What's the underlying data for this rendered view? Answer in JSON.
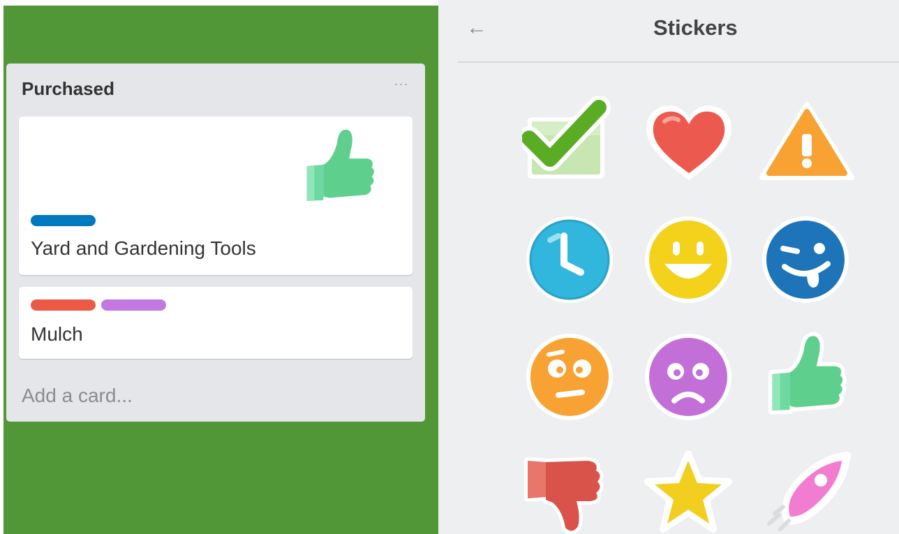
{
  "board": {
    "list": {
      "title": "Purchased",
      "menu_label": "···",
      "cards": [
        {
          "title": "Yard and Gardening Tools",
          "labels": [
            {
              "color": "#0079bf"
            }
          ],
          "sticker": "thumbs-up"
        },
        {
          "title": "Mulch",
          "labels": [
            {
              "color": "#eb5a46"
            },
            {
              "color": "#c377e0"
            }
          ]
        }
      ],
      "add_card": "Add a card..."
    }
  },
  "sticker_panel": {
    "back_label": "←",
    "title": "Stickers",
    "stickers": [
      "check",
      "heart",
      "warning",
      "clock",
      "smile",
      "laugh",
      "huh",
      "frown",
      "thumbs-up",
      "thumbs-down",
      "star",
      "rocketship"
    ]
  },
  "colors": {
    "board_background": "#529737",
    "list_background": "#e4e6e9",
    "panel_background": "#edeff0"
  }
}
